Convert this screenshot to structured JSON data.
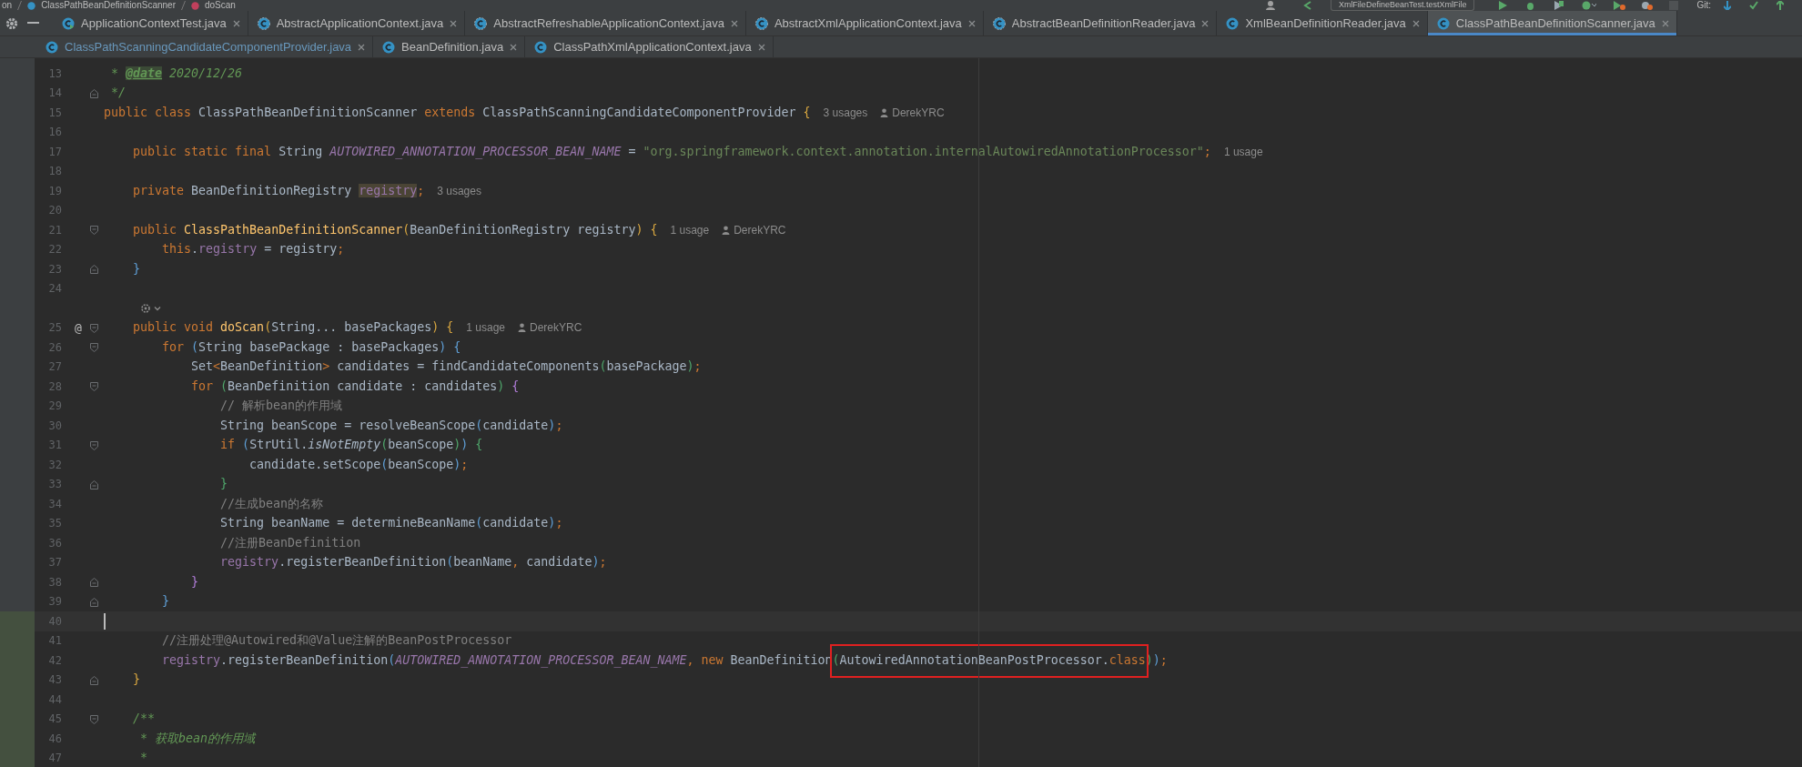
{
  "breadcrumb": [
    "on",
    "ClassPathBeanDefinitionScanner",
    "doScan"
  ],
  "toolbar": {
    "run_config": "XmlFileDefineBeanTest.testXmlFile",
    "vcs_label": "Git:"
  },
  "tab_rows": [
    [
      {
        "label": "ApplicationContextTest.java",
        "selected": false,
        "modified": false,
        "kind": "test"
      },
      {
        "label": "AbstractApplicationContext.java",
        "selected": false,
        "modified": false,
        "kind": "abstract"
      },
      {
        "label": "AbstractRefreshableApplicationContext.java",
        "selected": false,
        "modified": false,
        "kind": "abstract"
      },
      {
        "label": "AbstractXmlApplicationContext.java",
        "selected": false,
        "modified": false,
        "kind": "abstract"
      },
      {
        "label": "AbstractBeanDefinitionReader.java",
        "selected": false,
        "modified": false,
        "kind": "abstract"
      },
      {
        "label": "XmlBeanDefinitionReader.java",
        "selected": false,
        "modified": false,
        "kind": "class"
      },
      {
        "label": "ClassPathBeanDefinitionScanner.java",
        "selected": true,
        "modified": false,
        "kind": "class"
      }
    ],
    [
      {
        "label": "ClassPathScanningCandidateComponentProvider.java",
        "selected": false,
        "modified": true,
        "kind": "class"
      },
      {
        "label": "BeanDefinition.java",
        "selected": false,
        "modified": false,
        "kind": "class"
      },
      {
        "label": "ClassPathXmlApplicationContext.java",
        "selected": false,
        "modified": false,
        "kind": "class"
      }
    ]
  ],
  "editor": {
    "lines": [
      {
        "kind": "code",
        "number": "13",
        "tokens": [
          {
            "kind": "doc",
            "text": " * "
          },
          {
            "kind": "tag",
            "text": "@date"
          },
          {
            "kind": "doc",
            "text": " 2020/12/26"
          }
        ]
      },
      {
        "kind": "code",
        "number": "14",
        "fold_end": true,
        "tokens": [
          {
            "kind": "doc",
            "text": " */"
          }
        ]
      },
      {
        "kind": "code",
        "number": "15",
        "tokens": [
          {
            "kind": "keyword",
            "text": "public class "
          },
          {
            "kind": "plain",
            "text": "ClassPathBeanDefinitionScanner "
          },
          {
            "kind": "keyword",
            "text": "extends "
          },
          {
            "kind": "plain",
            "text": "ClassPathScanningCandidateComponentProvider "
          },
          {
            "kind": "bracket1",
            "text": "{"
          }
        ],
        "hints": [
          {
            "kind": "usages",
            "text": "3 usages"
          },
          {
            "kind": "author",
            "text": "DerekYRC"
          }
        ]
      },
      {
        "kind": "code",
        "number": "16"
      },
      {
        "kind": "code",
        "number": "17",
        "tokens": [
          {
            "kind": "keyword",
            "text": "    public static final "
          },
          {
            "kind": "plain",
            "text": "String "
          },
          {
            "kind": "constant",
            "text": "AUTOWIRED_ANNOTATION_PROCESSOR_BEAN_NAME"
          },
          {
            "kind": "plain",
            "text": " = "
          },
          {
            "kind": "string",
            "text": "\"org.springframework.context.annotation.internalAutowiredAnnotationProcessor\""
          },
          {
            "kind": "keyword",
            "text": ";"
          }
        ],
        "hints": [
          {
            "kind": "usages",
            "text": "1 usage"
          }
        ]
      },
      {
        "kind": "code",
        "number": "18"
      },
      {
        "kind": "code",
        "number": "19",
        "tokens": [
          {
            "kind": "keyword",
            "text": "    private "
          },
          {
            "kind": "plain",
            "text": "BeanDefinitionRegistry "
          },
          {
            "kind": "marked",
            "text": "registry"
          },
          {
            "kind": "keyword",
            "text": ";"
          }
        ],
        "hints": [
          {
            "kind": "usages",
            "text": "3 usages"
          }
        ]
      },
      {
        "kind": "code",
        "number": "20"
      },
      {
        "kind": "code",
        "number": "21",
        "fold_start": true,
        "tokens": [
          {
            "kind": "keyword",
            "text": "    public "
          },
          {
            "kind": "method",
            "text": "ClassPathBeanDefinitionScanner"
          },
          {
            "kind": "bracket1",
            "text": "("
          },
          {
            "kind": "plain",
            "text": "BeanDefinitionRegistry registry"
          },
          {
            "kind": "bracket1",
            "text": ") {"
          }
        ],
        "hints": [
          {
            "kind": "usages",
            "text": "1 usage"
          },
          {
            "kind": "author",
            "text": "DerekYRC"
          }
        ]
      },
      {
        "kind": "code",
        "number": "22",
        "tokens": [
          {
            "kind": "keyword",
            "text": "        this"
          },
          {
            "kind": "plain",
            "text": "."
          },
          {
            "kind": "field",
            "text": "registry"
          },
          {
            "kind": "plain",
            "text": " = registry"
          },
          {
            "kind": "keyword",
            "text": ";"
          }
        ]
      },
      {
        "kind": "code",
        "number": "23",
        "fold_end": true,
        "tokens": [
          {
            "kind": "bracket2",
            "text": "    }"
          }
        ]
      },
      {
        "kind": "code",
        "number": "24"
      },
      {
        "kind": "inlay"
      },
      {
        "kind": "code",
        "number": "25",
        "gutter": "@",
        "fold_start": true,
        "tokens": [
          {
            "kind": "keyword",
            "text": "    public void "
          },
          {
            "kind": "method",
            "text": "doScan"
          },
          {
            "kind": "bracket1",
            "text": "("
          },
          {
            "kind": "plain",
            "text": "String... basePackages"
          },
          {
            "kind": "bracket1",
            "text": ") {"
          }
        ],
        "hints": [
          {
            "kind": "usages",
            "text": "1 usage"
          },
          {
            "kind": "author",
            "text": "DerekYRC"
          }
        ]
      },
      {
        "kind": "code",
        "number": "26",
        "fold_start": true,
        "tokens": [
          {
            "kind": "keyword",
            "text": "        for "
          },
          {
            "kind": "bracket2",
            "text": "("
          },
          {
            "kind": "plain",
            "text": "String basePackage : basePackages"
          },
          {
            "kind": "bracket2",
            "text": ") {"
          }
        ]
      },
      {
        "kind": "code",
        "number": "27",
        "tokens": [
          {
            "kind": "plain",
            "text": "            Set"
          },
          {
            "kind": "keyword",
            "text": "<"
          },
          {
            "kind": "plain",
            "text": "BeanDefinition"
          },
          {
            "kind": "keyword",
            "text": ">"
          },
          {
            "kind": "plain",
            "text": " candidates = findCandidateComponents"
          },
          {
            "kind": "bracket3",
            "text": "("
          },
          {
            "kind": "plain",
            "text": "basePackage"
          },
          {
            "kind": "bracket3",
            "text": ")"
          },
          {
            "kind": "keyword",
            "text": ";"
          }
        ]
      },
      {
        "kind": "code",
        "number": "28",
        "fold_start": true,
        "tokens": [
          {
            "kind": "keyword",
            "text": "            for "
          },
          {
            "kind": "bracket3",
            "text": "("
          },
          {
            "kind": "plain",
            "text": "BeanDefinition candidate : candidates"
          },
          {
            "kind": "bracket3",
            "text": ")"
          },
          {
            "kind": "bracket4",
            "text": " {"
          }
        ]
      },
      {
        "kind": "code",
        "number": "29",
        "tokens": [
          {
            "kind": "comment",
            "text": "                // 解析bean的作用域"
          }
        ]
      },
      {
        "kind": "code",
        "number": "30",
        "tokens": [
          {
            "kind": "plain",
            "text": "                String beanScope = resolveBeanScope"
          },
          {
            "kind": "bracket2",
            "text": "("
          },
          {
            "kind": "plain",
            "text": "candidate"
          },
          {
            "kind": "bracket2",
            "text": ")"
          },
          {
            "kind": "keyword",
            "text": ";"
          }
        ]
      },
      {
        "kind": "code",
        "number": "31",
        "fold_start": true,
        "tokens": [
          {
            "kind": "keyword",
            "text": "                if "
          },
          {
            "kind": "bracket2",
            "text": "("
          },
          {
            "kind": "plain",
            "text": "StrUtil."
          },
          {
            "kind": "static",
            "text": "isNotEmpty"
          },
          {
            "kind": "bracket3",
            "text": "("
          },
          {
            "kind": "plain",
            "text": "beanScope"
          },
          {
            "kind": "bracket3",
            "text": ")"
          },
          {
            "kind": "bracket2",
            "text": ")"
          },
          {
            "kind": "bracket3",
            "text": " {"
          }
        ]
      },
      {
        "kind": "code",
        "number": "32",
        "tokens": [
          {
            "kind": "plain",
            "text": "                    candidate.setScope"
          },
          {
            "kind": "bracket2",
            "text": "("
          },
          {
            "kind": "plain",
            "text": "beanScope"
          },
          {
            "kind": "bracket2",
            "text": ")"
          },
          {
            "kind": "keyword",
            "text": ";"
          }
        ]
      },
      {
        "kind": "code",
        "number": "33",
        "fold_end": true,
        "tokens": [
          {
            "kind": "bracket3",
            "text": "                }"
          }
        ]
      },
      {
        "kind": "code",
        "number": "34",
        "tokens": [
          {
            "kind": "comment",
            "text": "                //生成bean的名称"
          }
        ]
      },
      {
        "kind": "code",
        "number": "35",
        "tokens": [
          {
            "kind": "plain",
            "text": "                String beanName = determineBeanName"
          },
          {
            "kind": "bracket2",
            "text": "("
          },
          {
            "kind": "plain",
            "text": "candidate"
          },
          {
            "kind": "bracket2",
            "text": ")"
          },
          {
            "kind": "keyword",
            "text": ";"
          }
        ]
      },
      {
        "kind": "code",
        "number": "36",
        "tokens": [
          {
            "kind": "comment",
            "text": "                //注册BeanDefinition"
          }
        ]
      },
      {
        "kind": "code",
        "number": "37",
        "tokens": [
          {
            "kind": "field",
            "text": "                registry"
          },
          {
            "kind": "plain",
            "text": ".registerBeanDefinition"
          },
          {
            "kind": "bracket2",
            "text": "("
          },
          {
            "kind": "plain",
            "text": "beanName"
          },
          {
            "kind": "keyword",
            "text": ", "
          },
          {
            "kind": "plain",
            "text": "candidate"
          },
          {
            "kind": "bracket2",
            "text": ")"
          },
          {
            "kind": "keyword",
            "text": ";"
          }
        ]
      },
      {
        "kind": "code",
        "number": "38",
        "fold_end": true,
        "tokens": [
          {
            "kind": "bracket4",
            "text": "            }"
          }
        ]
      },
      {
        "kind": "code",
        "number": "39",
        "fold_end": true,
        "tokens": [
          {
            "kind": "bracket2",
            "text": "        }"
          }
        ]
      },
      {
        "kind": "code",
        "number": "40",
        "current": true,
        "changed": true
      },
      {
        "kind": "code",
        "number": "41",
        "changed": true,
        "tokens": [
          {
            "kind": "comment",
            "text": "        //注册处理@Autowired和@Value注解的BeanPostProcessor"
          }
        ]
      },
      {
        "kind": "code",
        "number": "42",
        "changed": true,
        "tokens": [
          {
            "kind": "field",
            "text": "        registry"
          },
          {
            "kind": "plain",
            "text": ".registerBeanDefinition"
          },
          {
            "kind": "bracket2",
            "text": "("
          },
          {
            "kind": "constant",
            "text": "AUTOWIRED_ANNOTATION_PROCESSOR_BEAN_NAME"
          },
          {
            "kind": "keyword",
            "text": ", new "
          },
          {
            "kind": "plain",
            "text": "BeanDefinition"
          },
          {
            "kind": "boxed",
            "parts": [
              {
                "kind": "bracket3",
                "text": "("
              },
              {
                "kind": "plain",
                "text": "AutowiredAnnotationBeanPostProcessor."
              },
              {
                "kind": "keyword",
                "text": "class"
              }
            ]
          },
          {
            "kind": "bracket3",
            "text": ")"
          },
          {
            "kind": "bracket2",
            "text": ")"
          },
          {
            "kind": "keyword",
            "text": ";"
          }
        ]
      },
      {
        "kind": "code",
        "number": "43",
        "fold_end": true,
        "changed": true,
        "tokens": [
          {
            "kind": "bracket1",
            "text": "    }"
          }
        ]
      },
      {
        "kind": "code",
        "number": "44",
        "changed": true
      },
      {
        "kind": "code",
        "number": "45",
        "fold_start": true,
        "changed": true,
        "tokens": [
          {
            "kind": "doc",
            "text": "    /**"
          }
        ]
      },
      {
        "kind": "code",
        "number": "46",
        "changed": true,
        "tokens": [
          {
            "kind": "doc",
            "text": "     * 获取bean的作用域"
          }
        ]
      },
      {
        "kind": "code",
        "number": "47",
        "changed": true,
        "tokens": [
          {
            "kind": "doc",
            "text": "     *"
          }
        ]
      }
    ]
  }
}
